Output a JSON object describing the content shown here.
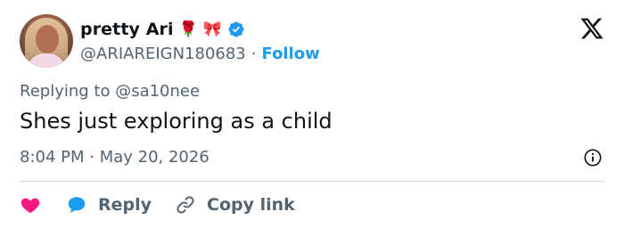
{
  "author": {
    "display_name": "pretty Ari",
    "emojis": [
      "🌹",
      "🎀"
    ],
    "handle": "@ARIAREIGN180683",
    "separator": "·",
    "follow_label": "Follow"
  },
  "tweet": {
    "replying_to": "Replying to @sa10nee",
    "text": "Shes just exploring as a child",
    "timestamp": "8:04 PM · May 20, 2026"
  },
  "actions": {
    "reply_label": "Reply",
    "copy_label": "Copy link"
  },
  "colors": {
    "accent": "#1d9bf0",
    "text": "#0f1419",
    "muted": "#536471",
    "like": "#f91880",
    "divider": "#cfd9de"
  },
  "icons": [
    "x-logo-icon",
    "verified-badge-icon",
    "heart-icon",
    "reply-bubble-icon",
    "link-icon",
    "info-icon"
  ]
}
